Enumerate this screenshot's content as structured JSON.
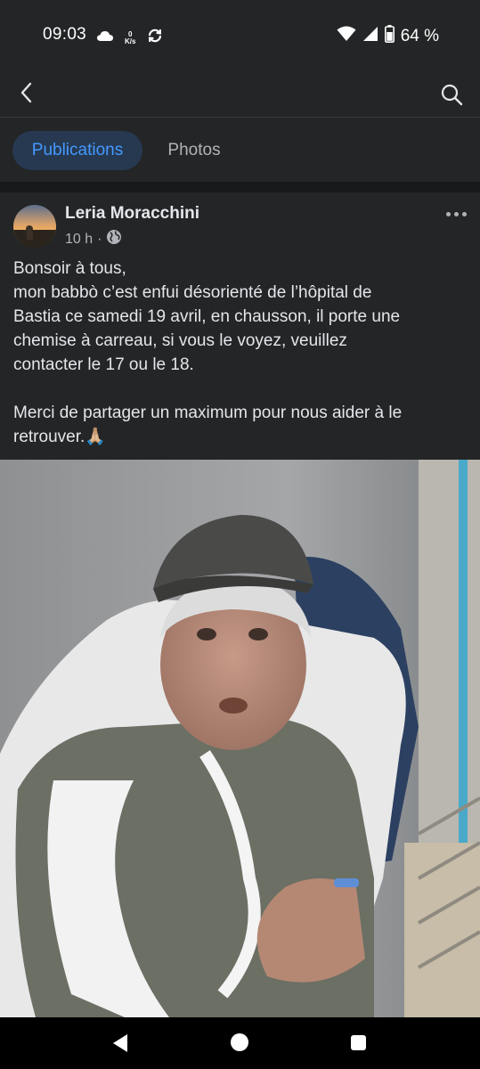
{
  "status_bar": {
    "time": "09:03",
    "net_speed_value": "0",
    "net_speed_unit": "K/s",
    "battery": "64 %"
  },
  "header": {
    "back_icon": "back-arrow-icon",
    "search_icon": "search-icon"
  },
  "tabs": [
    {
      "label": "Publications",
      "active": true
    },
    {
      "label": "Photos",
      "active": false
    }
  ],
  "post": {
    "author": "Leria Moracchini",
    "time": "10 h",
    "separator": "·",
    "audience_icon": "globe-icon",
    "text_lines": [
      "Bonsoir à tous,",
      "mon babbò c’est enfui désorienté de l’hôpital de",
      "Bastia ce samedi 19 avril, en chausson, il porte une",
      "chemise à carreau, si vous le voyez, veuillez",
      "contacter le 17 ou le 18."
    ],
    "text_lines_2": [
      "Merci de partager un maximum pour nous aider à le",
      "retrouver.🙏🏼"
    ]
  },
  "colors": {
    "background": "#242526",
    "accent": "#4599ff",
    "active_tab_bg": "#263951",
    "secondary_text": "#b0b3b8"
  }
}
